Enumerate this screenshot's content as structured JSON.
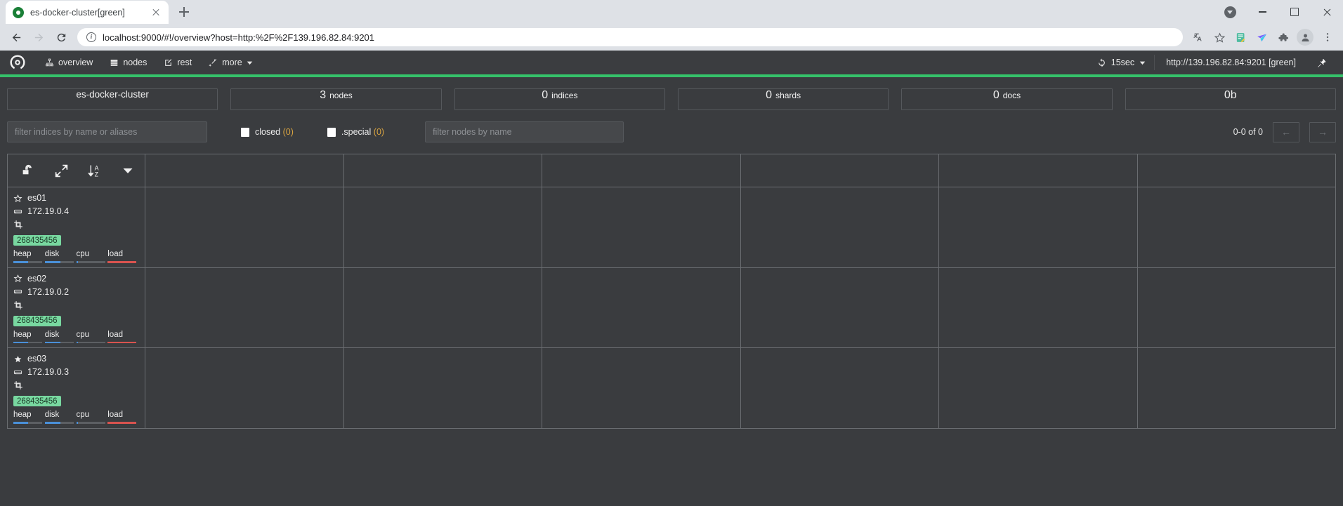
{
  "browser": {
    "tab": {
      "title": "es-docker-cluster[green]",
      "favicon": "cerebro-icon"
    },
    "new_tab_label": "+",
    "window_controls": [
      "downloads-badge",
      "minimize",
      "maximize",
      "close"
    ],
    "nav": {
      "back": "←",
      "forward": "→",
      "reload": "⟳"
    },
    "omnibox": {
      "value": "localhost:9000/#!/overview?host=http:%2F%2F139.196.82.84:9201",
      "info_icon": "i"
    },
    "toolbar_icons": [
      "translate-icon",
      "bookmark-star-icon",
      "notes-extension-icon",
      "extension-icon",
      "puzzle-extension-icon",
      "profile-avatar",
      "chrome-menu-icon"
    ]
  },
  "app": {
    "brand": "cerebro-logo",
    "nav_links": [
      {
        "icon": "sitemap-icon",
        "label": "overview"
      },
      {
        "icon": "server-icon",
        "label": "nodes"
      },
      {
        "icon": "pencil-square-icon",
        "label": "rest"
      },
      {
        "icon": "magic-wand-icon",
        "label": "more",
        "caret": true
      }
    ],
    "refresh": {
      "icon": "refresh-icon",
      "label": "15sec",
      "caret": true
    },
    "host": "http://139.196.82.84:9201 [green]",
    "plug_icon": "plug-icon",
    "health_color": "#35c26a"
  },
  "stats": [
    {
      "name": "es-docker-cluster",
      "value": "",
      "label": ""
    },
    {
      "name": "",
      "value": "3",
      "label": "nodes"
    },
    {
      "name": "",
      "value": "0",
      "label": "indices"
    },
    {
      "name": "",
      "value": "0",
      "label": "shards"
    },
    {
      "name": "",
      "value": "0",
      "label": "docs"
    },
    {
      "name": "",
      "value": "0b",
      "label": ""
    }
  ],
  "filters": {
    "indices_placeholder": "filter indices by name or aliases",
    "indices_value": "",
    "nodes_placeholder": "filter nodes by name",
    "nodes_value": "",
    "checkboxes": [
      {
        "label": "closed",
        "count": "(0)",
        "checked": false
      },
      {
        "label": ".special",
        "count": "(0)",
        "checked": false
      }
    ]
  },
  "pager": {
    "range": "0-0 of 0",
    "prev": "←",
    "next": "→"
  },
  "table": {
    "toolbar": [
      {
        "name": "unlock-icon"
      },
      {
        "name": "expand-arrows-icon"
      },
      {
        "name": "sort-alpha-asc-icon"
      },
      {
        "name": "chevron-down-icon"
      }
    ],
    "column_count": 7,
    "nodes": [
      {
        "name": "es01",
        "master": false,
        "ip": "172.19.0.4",
        "badge": "268435456",
        "metrics": [
          {
            "label": "heap",
            "pct": 50,
            "color": "#4a90d9"
          },
          {
            "label": "disk",
            "pct": 55,
            "color": "#4a90d9"
          },
          {
            "label": "cpu",
            "pct": 5,
            "color": "#4a90d9"
          },
          {
            "label": "load",
            "pct": 100,
            "color": "#d9534f"
          }
        ]
      },
      {
        "name": "es02",
        "master": false,
        "ip": "172.19.0.2",
        "badge": "268435456",
        "metrics": [
          {
            "label": "heap",
            "pct": 50,
            "color": "#4a90d9"
          },
          {
            "label": "disk",
            "pct": 55,
            "color": "#4a90d9"
          },
          {
            "label": "cpu",
            "pct": 5,
            "color": "#4a90d9"
          },
          {
            "label": "load",
            "pct": 100,
            "color": "#d9534f"
          }
        ]
      },
      {
        "name": "es03",
        "master": true,
        "ip": "172.19.0.3",
        "badge": "268435456",
        "metrics": [
          {
            "label": "heap",
            "pct": 50,
            "color": "#4a90d9"
          },
          {
            "label": "disk",
            "pct": 55,
            "color": "#4a90d9"
          },
          {
            "label": "cpu",
            "pct": 5,
            "color": "#4a90d9"
          },
          {
            "label": "load",
            "pct": 100,
            "color": "#d9534f"
          }
        ]
      }
    ]
  }
}
